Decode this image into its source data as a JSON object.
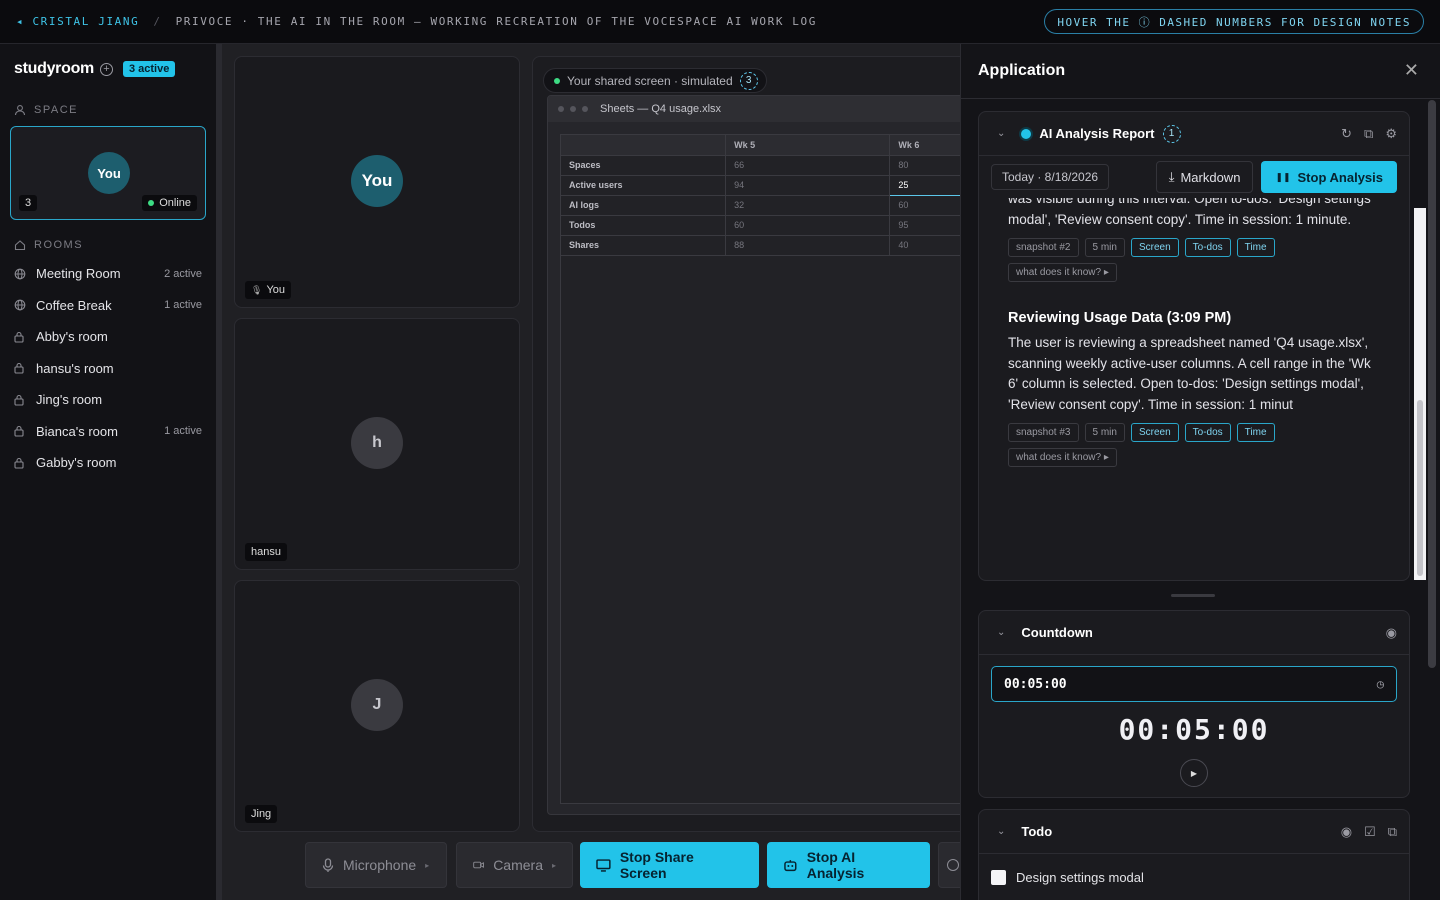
{
  "topbar": {
    "back": "◂ CRISTAL JIANG",
    "separator": "/",
    "crumb": "PRIVOCE · THE AI IN THE ROOM — WORKING RECREATION OF THE VOCESPACE AI WORK LOG",
    "hint": "HOVER THE ⓘ DASHED NUMBERS FOR DESIGN NOTES"
  },
  "sidebar": {
    "space_name": "studyroom",
    "active_badge": "3 active",
    "space_label": "SPACE",
    "space_card": {
      "avatar": "You",
      "count": "3",
      "status": "Online"
    },
    "rooms_label": "ROOMS",
    "rooms": [
      {
        "name": "Meeting Room",
        "count": "2 active",
        "icon": "globe-icon"
      },
      {
        "name": "Coffee Break",
        "count": "1 active",
        "icon": "globe-icon"
      },
      {
        "name": "Abby's room",
        "count": "",
        "icon": "lock-icon"
      },
      {
        "name": "hansu's room",
        "count": "",
        "icon": "lock-icon"
      },
      {
        "name": "Jing's room",
        "count": "",
        "icon": "lock-icon"
      },
      {
        "name": "Bianca's room",
        "count": "1 active",
        "icon": "lock-icon"
      },
      {
        "name": "Gabby's room",
        "count": "",
        "icon": "lock-icon"
      }
    ]
  },
  "participants": [
    {
      "avatar": "You",
      "name": "You"
    },
    {
      "avatar": "h",
      "name": "hansu"
    },
    {
      "avatar": "J",
      "name": "Jing"
    }
  ],
  "screen": {
    "pill": "Your shared screen · simulated",
    "note_number": "3",
    "window_title": "Sheets — Q4 usage.xlsx",
    "columns": [
      "",
      "Wk 5",
      "Wk 6"
    ],
    "rows": [
      [
        "Spaces",
        "66",
        "80"
      ],
      [
        "Active users",
        "94",
        "25"
      ],
      [
        "AI logs",
        "32",
        "60"
      ],
      [
        "Todos",
        "60",
        "95"
      ],
      [
        "Shares",
        "88",
        "40"
      ]
    ]
  },
  "controls": {
    "microphone": "Microphone",
    "camera": "Camera",
    "stop_share": "Stop Share Screen",
    "stop_ai": "Stop AI Analysis"
  },
  "panel": {
    "title": "Application",
    "ai": {
      "title": "AI Analysis Report",
      "note_number": "1",
      "date": "Today · 8/18/2026",
      "markdown": "Markdown",
      "stop": "Stop Analysis",
      "entry1_text": "was visible during this interval. Open to-dos: 'Design settings modal', 'Review consent copy'. Time in session: 1 minute.",
      "entry1_chips": [
        "snapshot #2",
        "5 min",
        "Screen",
        "To-dos",
        "Time"
      ],
      "entry1_ask": "what does it know? ▸",
      "entry2_heading": "Reviewing Usage Data (3:09 PM)",
      "entry2_text": "The user is reviewing a spreadsheet named 'Q4 usage.xlsx', scanning weekly active-user columns. A cell range in the 'Wk 6' column is selected. Open to-dos: 'Design settings modal', 'Review consent copy'. Time in session: 1 minut",
      "entry2_chips": [
        "snapshot #3",
        "5 min",
        "Screen",
        "To-dos",
        "Time"
      ],
      "entry2_ask": "what does it know? ▸"
    },
    "countdown": {
      "title": "Countdown",
      "input": "00:05:00",
      "display": "00:05:00"
    },
    "todo": {
      "title": "Todo",
      "items": [
        "Design settings modal"
      ]
    }
  }
}
